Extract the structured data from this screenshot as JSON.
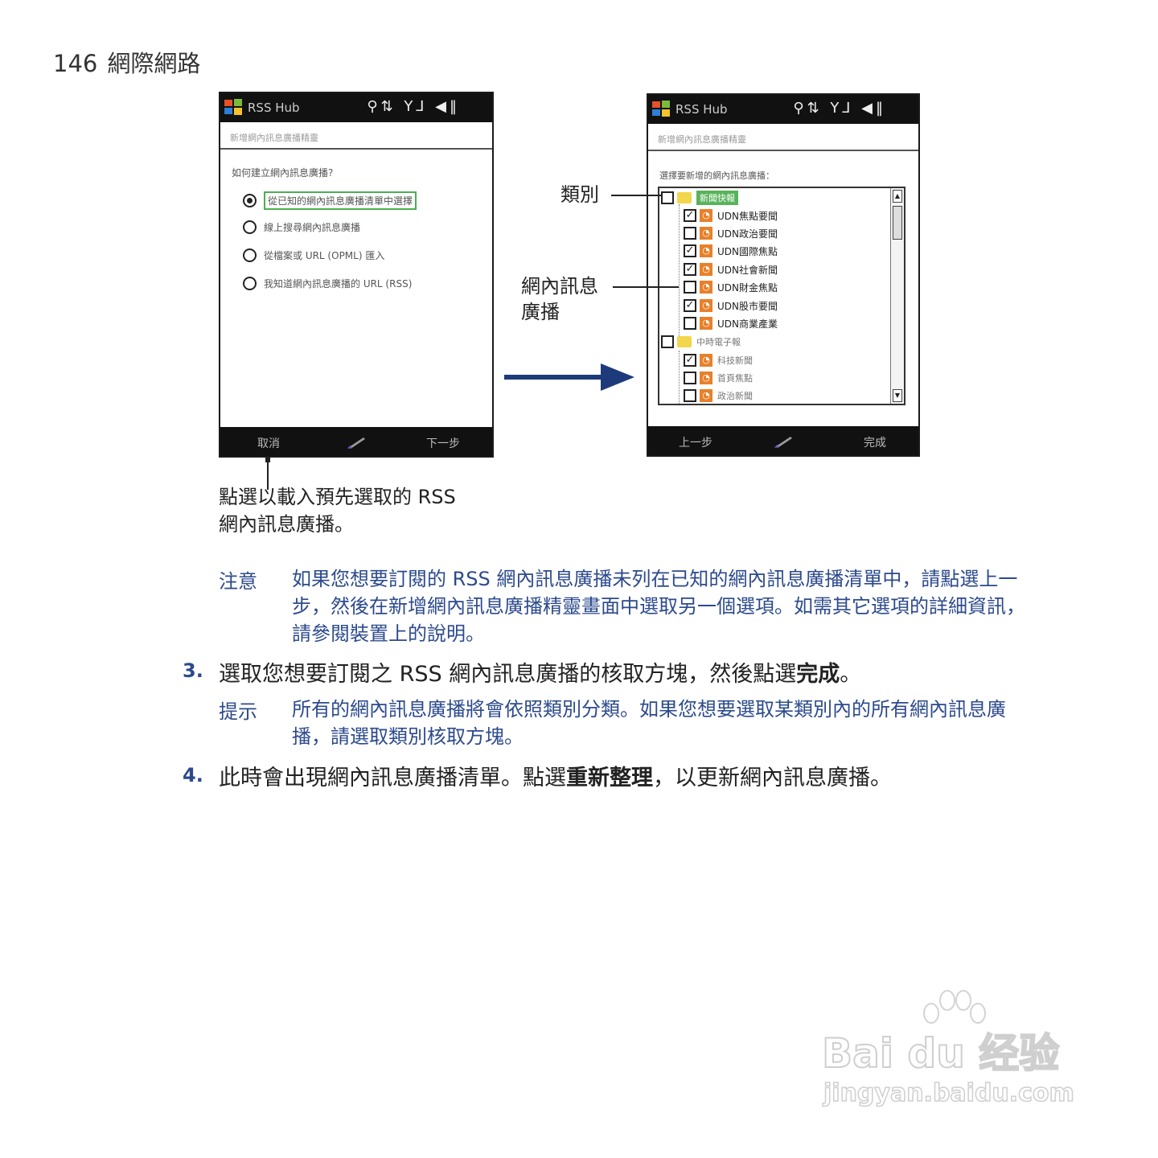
{
  "header": {
    "page_number": "146",
    "title": "網際網路"
  },
  "left_phone": {
    "app_name": "RSS Hub",
    "status_icons": "⚲⇅ Y⅃ ◀‖",
    "subtitle": "新增網內訊息廣播精靈",
    "question": "如何建立網內訊息廣播?",
    "options": [
      {
        "label": "從已知的網內訊息廣播清單中選擇",
        "selected": true
      },
      {
        "label": "線上搜尋網內訊息廣播",
        "selected": false
      },
      {
        "label": "從檔案或 URL (OPML) 匯入",
        "selected": false
      },
      {
        "label": "我知道網內訊息廣播的 URL (RSS)",
        "selected": false
      }
    ],
    "soft_left": "取消",
    "soft_right": "下一步"
  },
  "right_phone": {
    "app_name": "RSS Hub",
    "status_icons": "⚲⇅ Y⅃ ◀‖",
    "subtitle": "新增網內訊息廣播精靈",
    "prompt": "選擇要新增的網內訊息廣播：",
    "items": [
      {
        "type": "category",
        "label": "新聞快報",
        "checked": false,
        "highlight": true
      },
      {
        "type": "feed",
        "label": "UDN焦點要聞",
        "checked": true
      },
      {
        "type": "feed",
        "label": "UDN政治要聞",
        "checked": false
      },
      {
        "type": "feed",
        "label": "UDN國際焦點",
        "checked": true
      },
      {
        "type": "feed",
        "label": "UDN社會新聞",
        "checked": true
      },
      {
        "type": "feed",
        "label": "UDN財金焦點",
        "checked": false
      },
      {
        "type": "feed",
        "label": "UDN股市要聞",
        "checked": true
      },
      {
        "type": "feed",
        "label": "UDN商業產業",
        "checked": false
      },
      {
        "type": "category",
        "label": "中時電子報",
        "checked": false,
        "highlight": false
      },
      {
        "type": "feed",
        "label": "科技新聞",
        "checked": true
      },
      {
        "type": "feed",
        "label": "首頁焦點",
        "checked": false
      },
      {
        "type": "feed",
        "label": "政治新聞",
        "checked": false
      }
    ],
    "soft_left": "上一步",
    "soft_right": "完成"
  },
  "callouts": {
    "category": "類別",
    "feed_line1": "網內訊息",
    "feed_line2": "廣播"
  },
  "caption": {
    "line1": "點選以載入預先選取的 RSS",
    "line2": "網內訊息廣播。"
  },
  "note": {
    "label": "注意",
    "text": "如果您想要訂閱的 RSS 網內訊息廣播未列在已知的網內訊息廣播清單中，請點選上一步，然後在新增網內訊息廣播精靈畫面中選取另一個選項。如需其它選項的詳細資訊，請參閱裝置上的說明。"
  },
  "step3": {
    "number": "3.",
    "text_before": "選取您想要訂閱之 RSS 網內訊息廣播的核取方塊，然後點選",
    "bold": "完成",
    "text_after": "。"
  },
  "tip": {
    "label": "提示",
    "text": "所有的網內訊息廣播將會依照類別分類。如果您想要選取某類別內的所有網內訊息廣播，請選取類別核取方塊。"
  },
  "step4": {
    "number": "4.",
    "text_before": "此時會出現網內訊息廣播清單。點選",
    "bold": "重新整理",
    "text_after": "，以更新網內訊息廣播。"
  },
  "watermark": {
    "brand": "Bai du 经验",
    "url": "jingyan.baidu.com"
  },
  "colors": {
    "accent_blue": "#2c4a8c",
    "arrow_blue": "#1d3a7a",
    "rss_orange": "#e8802a",
    "category_green": "#59b35a"
  }
}
